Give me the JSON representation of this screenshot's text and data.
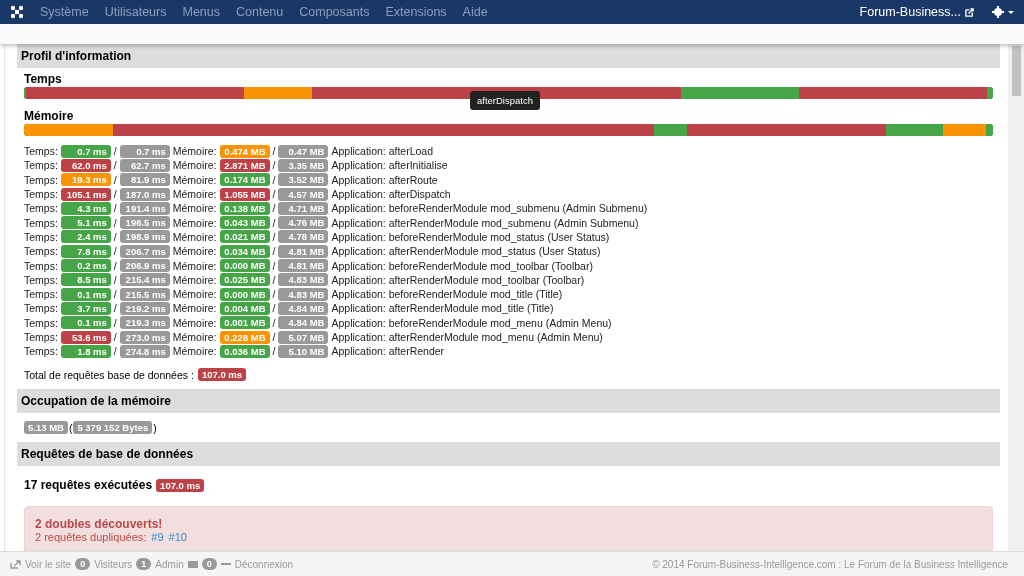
{
  "navbar": {
    "menu": [
      "Système",
      "Utilisateurs",
      "Menus",
      "Contenu",
      "Composants",
      "Extensions",
      "Aide"
    ],
    "site_link": "Forum-Business..."
  },
  "profile": {
    "title": "Profil d'information",
    "time_label": "Temps",
    "memory_label": "Mémoire",
    "tooltip": "afterDispatch",
    "rows": [
      {
        "time_label": "Temps:",
        "time": {
          "text": "0.7 ms",
          "color": "#46a546"
        },
        "time_separator": "/",
        "time_total": "0.7 ms",
        "memory_label": "Mémoire:",
        "memory": {
          "text": "0.474 MB",
          "color": "#f89406"
        },
        "memory_separator": "/",
        "memory_total": "0.47 MB",
        "event": "Application: afterLoad"
      },
      {
        "time_label": "Temps:",
        "time": {
          "text": "62.0 ms",
          "color": "#bd4247"
        },
        "time_separator": "/",
        "time_total": "62.7 ms",
        "memory_label": "Mémoire:",
        "memory": {
          "text": "2.871 MB",
          "color": "#bd4247"
        },
        "memory_separator": "/",
        "memory_total": "3.35 MB",
        "event": "Application: afterInitialise"
      },
      {
        "time_label": "Temps:",
        "time": {
          "text": "19.3 ms",
          "color": "#f89406"
        },
        "time_separator": "/",
        "time_total": "81.9 ms",
        "memory_label": "Mémoire:",
        "memory": {
          "text": "0.174 MB",
          "color": "#46a546"
        },
        "memory_separator": "/",
        "memory_total": "3.52 MB",
        "event": "Application: afterRoute"
      },
      {
        "time_label": "Temps:",
        "time": {
          "text": "105.1 ms",
          "color": "#bd4247"
        },
        "time_separator": "/",
        "time_total": "187.0 ms",
        "memory_label": "Mémoire:",
        "memory": {
          "text": "1.055 MB",
          "color": "#bd4247"
        },
        "memory_separator": "/",
        "memory_total": "4.57 MB",
        "event": "Application: afterDispatch"
      },
      {
        "time_label": "Temps:",
        "time": {
          "text": "4.3 ms",
          "color": "#46a546"
        },
        "time_separator": "/",
        "time_total": "191.4 ms",
        "memory_label": "Mémoire:",
        "memory": {
          "text": "0.138 MB",
          "color": "#46a546"
        },
        "memory_separator": "/",
        "memory_total": "4.71 MB",
        "event": "Application: beforeRenderModule mod_submenu (Admin Submenu)"
      },
      {
        "time_label": "Temps:",
        "time": {
          "text": "5.1 ms",
          "color": "#46a546"
        },
        "time_separator": "/",
        "time_total": "196.5 ms",
        "memory_label": "Mémoire:",
        "memory": {
          "text": "0.043 MB",
          "color": "#46a546"
        },
        "memory_separator": "/",
        "memory_total": "4.76 MB",
        "event": "Application: afterRenderModule mod_submenu (Admin Submenu)"
      },
      {
        "time_label": "Temps:",
        "time": {
          "text": "2.4 ms",
          "color": "#46a546"
        },
        "time_separator": "/",
        "time_total": "198.9 ms",
        "memory_label": "Mémoire:",
        "memory": {
          "text": "0.021 MB",
          "color": "#46a546"
        },
        "memory_separator": "/",
        "memory_total": "4.78 MB",
        "event": "Application: beforeRenderModule mod_status (User Status)"
      },
      {
        "time_label": "Temps:",
        "time": {
          "text": "7.8 ms",
          "color": "#46a546"
        },
        "time_separator": "/",
        "time_total": "206.7 ms",
        "memory_label": "Mémoire:",
        "memory": {
          "text": "0.034 MB",
          "color": "#46a546"
        },
        "memory_separator": "/",
        "memory_total": "4.81 MB",
        "event": "Application: afterRenderModule mod_status (User Status)"
      },
      {
        "time_label": "Temps:",
        "time": {
          "text": "0.2 ms",
          "color": "#46a546"
        },
        "time_separator": "/",
        "time_total": "206.9 ms",
        "memory_label": "Mémoire:",
        "memory": {
          "text": "0.000 MB",
          "color": "#46a546"
        },
        "memory_separator": "/",
        "memory_total": "4.81 MB",
        "event": "Application: beforeRenderModule mod_toolbar (Toolbar)"
      },
      {
        "time_label": "Temps:",
        "time": {
          "text": "8.5 ms",
          "color": "#46a546"
        },
        "time_separator": "/",
        "time_total": "215.4 ms",
        "memory_label": "Mémoire:",
        "memory": {
          "text": "0.025 MB",
          "color": "#46a546"
        },
        "memory_separator": "/",
        "memory_total": "4.83 MB",
        "event": "Application: afterRenderModule mod_toolbar (Toolbar)"
      },
      {
        "time_label": "Temps:",
        "time": {
          "text": "0.1 ms",
          "color": "#46a546"
        },
        "time_separator": "/",
        "time_total": "215.5 ms",
        "memory_label": "Mémoire:",
        "memory": {
          "text": "0.000 MB",
          "color": "#46a546"
        },
        "memory_separator": "/",
        "memory_total": "4.83 MB",
        "event": "Application: beforeRenderModule mod_title (Title)"
      },
      {
        "time_label": "Temps:",
        "time": {
          "text": "3.7 ms",
          "color": "#46a546"
        },
        "time_separator": "/",
        "time_total": "219.2 ms",
        "memory_label": "Mémoire:",
        "memory": {
          "text": "0.004 MB",
          "color": "#46a546"
        },
        "memory_separator": "/",
        "memory_total": "4.84 MB",
        "event": "Application: afterRenderModule mod_title (Title)"
      },
      {
        "time_label": "Temps:",
        "time": {
          "text": "0.1 ms",
          "color": "#46a546"
        },
        "time_separator": "/",
        "time_total": "219.3 ms",
        "memory_label": "Mémoire:",
        "memory": {
          "text": "0.001 MB",
          "color": "#46a546"
        },
        "memory_separator": "/",
        "memory_total": "4.84 MB",
        "event": "Application: beforeRenderModule mod_menu (Admin Menu)"
      },
      {
        "time_label": "Temps:",
        "time": {
          "text": "53.6 ms",
          "color": "#bd4247"
        },
        "time_separator": "/",
        "time_total": "273.0 ms",
        "memory_label": "Mémoire:",
        "memory": {
          "text": "0.228 MB",
          "color": "#f89406"
        },
        "memory_separator": "/",
        "memory_total": "5.07 MB",
        "event": "Application: afterRenderModule mod_menu (Admin Menu)"
      },
      {
        "time_label": "Temps:",
        "time": {
          "text": "1.8 ms",
          "color": "#46a546"
        },
        "time_separator": "/",
        "time_total": "274.8 ms",
        "memory_label": "Mémoire:",
        "memory": {
          "text": "0.036 MB",
          "color": "#46a546"
        },
        "memory_separator": "/",
        "memory_total": "5.10 MB",
        "event": "Application: afterRender"
      }
    ],
    "db_total_label": "Total de requêtes base de données :",
    "db_total": "107.0 ms"
  },
  "memory": {
    "title": "Occupation de la mémoire",
    "megabytes": "5.13 MB",
    "open_paren": "(",
    "bytes": "5 379 152 Bytes",
    "close_paren": ")"
  },
  "queries": {
    "title": "Requêtes de base de données",
    "count": "17 requêtes exécutées",
    "time": "107.0 ms",
    "alert": {
      "title": "2 doubles découverts!",
      "text": "2 requêtes dupliquées:",
      "links": [
        "#9",
        "#10"
      ]
    }
  },
  "footer": {
    "view_site": "Voir le site",
    "visitors_count": "0",
    "visitors": "Visiteurs",
    "admin_count": "1",
    "admin": "Admin",
    "messages_count": "0",
    "logout": "Déconnexion",
    "copyright": "© 2014 Forum-Business-Intelligence.com : Le Forum de la Business Intelligence"
  }
}
